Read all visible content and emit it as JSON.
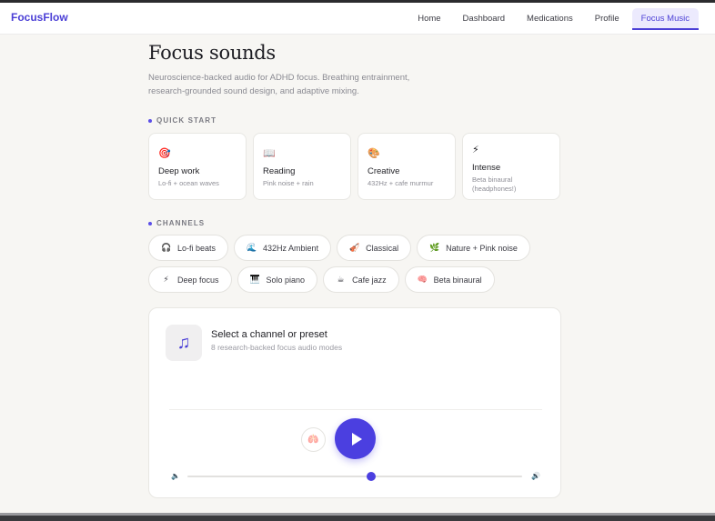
{
  "brand": "FocusFlow",
  "nav": [
    {
      "label": "Home",
      "active": false
    },
    {
      "label": "Dashboard",
      "active": false
    },
    {
      "label": "Medications",
      "active": false
    },
    {
      "label": "Profile",
      "active": false
    },
    {
      "label": "Focus Music",
      "active": true
    }
  ],
  "page": {
    "title": "Focus sounds",
    "subtitle": "Neuroscience-backed audio for ADHD focus. Breathing entrainment, research-grounded sound design, and adaptive mixing."
  },
  "quick_start": {
    "label": "QUICK START",
    "presets": [
      {
        "icon": "🎯",
        "icon_name": "target-icon",
        "name": "Deep work",
        "desc": "Lo-fi + ocean waves"
      },
      {
        "icon": "📖",
        "icon_name": "book-icon",
        "name": "Reading",
        "desc": "Pink noise + rain"
      },
      {
        "icon": "🎨",
        "icon_name": "palette-icon",
        "name": "Creative",
        "desc": "432Hz + cafe murmur"
      },
      {
        "icon": "⚡",
        "icon_name": "lightning-icon",
        "name": "Intense",
        "desc": "Beta binaural (headphones!)"
      }
    ]
  },
  "channels": {
    "label": "CHANNELS",
    "items": [
      {
        "icon": "🎧",
        "icon_name": "headphones-icon",
        "label": "Lo-fi beats"
      },
      {
        "icon": "🌊",
        "icon_name": "wave-icon",
        "label": "432Hz Ambient"
      },
      {
        "icon": "🎻",
        "icon_name": "violin-icon",
        "label": "Classical"
      },
      {
        "icon": "🌿",
        "icon_name": "herb-icon",
        "label": "Nature + Pink noise"
      },
      {
        "icon": "⚡",
        "icon_name": "lightning-icon",
        "label": "Deep focus"
      },
      {
        "icon": "🎹",
        "icon_name": "piano-icon",
        "label": "Solo piano"
      },
      {
        "icon": "☕",
        "icon_name": "coffee-icon",
        "label": "Cafe jazz"
      },
      {
        "icon": "🧠",
        "icon_name": "brain-icon",
        "label": "Beta binaural"
      }
    ]
  },
  "player": {
    "art_icon": "♫",
    "title": "Select a channel or preset",
    "subtitle": "8 research-backed focus audio modes",
    "breath_icon": "🫁",
    "volume_low_icon": "🔈",
    "volume_high_icon": "🔊",
    "volume": 0.55
  },
  "colors": {
    "accent": "#4b3fe0",
    "background": "#f7f6f3"
  }
}
